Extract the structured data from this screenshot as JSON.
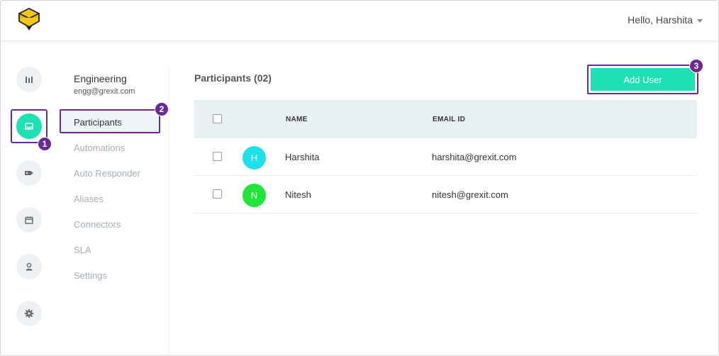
{
  "header": {
    "greeting": "Hello, Harshita",
    "logo_icon": "cube-logo-icon",
    "brand_color": "#f5c518"
  },
  "icon_rail": {
    "items": [
      {
        "name": "analytics-icon"
      },
      {
        "name": "inbox-icon",
        "active": true
      },
      {
        "name": "tag-icon"
      },
      {
        "name": "calendar-icon"
      },
      {
        "name": "user-icon"
      },
      {
        "name": "gear-icon"
      }
    ]
  },
  "team": {
    "name": "Engineering",
    "email": "engg@grexit.com"
  },
  "nav": {
    "items": [
      {
        "label": "Participants",
        "active": true
      },
      {
        "label": "Automations"
      },
      {
        "label": "Auto Responder"
      },
      {
        "label": "Aliases"
      },
      {
        "label": "Connectors"
      },
      {
        "label": "SLA"
      },
      {
        "label": "Settings"
      }
    ]
  },
  "main": {
    "title": "Participants (02)",
    "add_button_label": "Add User"
  },
  "table": {
    "columns": [
      "NAME",
      "EMAIL ID"
    ],
    "rows": [
      {
        "initial": "H",
        "name": "Harshita",
        "email": "harshita@grexit.com",
        "avatar_color": "#1ee0e8"
      },
      {
        "initial": "N",
        "name": "Nitesh",
        "email": "nitesh@grexit.com",
        "avatar_color": "#22e33a"
      }
    ]
  },
  "badges": {
    "one": "1",
    "two": "2",
    "three": "3"
  },
  "colors": {
    "accent": "#1de0b3",
    "highlight": "#6a2a91"
  }
}
